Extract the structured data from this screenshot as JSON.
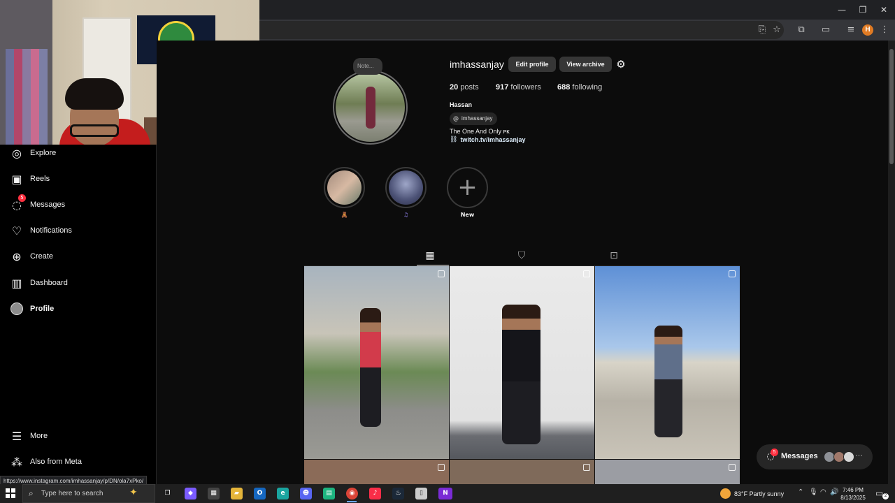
{
  "browser": {
    "window_controls": {
      "minimize": "—",
      "restore": "❐",
      "close": "✕"
    },
    "toolbar_icons": [
      "install-app-icon",
      "star-icon",
      "extensions-icon",
      "split-tab-icon",
      "media-icon"
    ],
    "profile_initial": "H",
    "menu_glyph": "⋮"
  },
  "sidebar": {
    "items": [
      {
        "label": "Explore",
        "icon": "compass-icon",
        "glyph": "◎"
      },
      {
        "label": "Reels",
        "icon": "reels-icon",
        "glyph": "▣"
      },
      {
        "label": "Messages",
        "icon": "messenger-icon",
        "glyph": "◌",
        "badge": "5"
      },
      {
        "label": "Notifications",
        "icon": "heart-icon",
        "glyph": "♡"
      },
      {
        "label": "Create",
        "icon": "plus-square-icon",
        "glyph": "⊕"
      },
      {
        "label": "Dashboard",
        "icon": "chart-icon",
        "glyph": "▥"
      },
      {
        "label": "Profile",
        "icon": "profile-avatar-icon",
        "glyph": ""
      }
    ],
    "more": {
      "label": "More",
      "glyph": "☰"
    },
    "also_from_meta": {
      "label": "Also from Meta",
      "glyph": "⁂"
    }
  },
  "status_url": "https://www.instagram.com/imhassanjay/p/DN/ola7xPko/",
  "profile": {
    "note_placeholder": "Note...",
    "username": "imhassanjay",
    "edit_profile_label": "Edit profile",
    "view_archive_label": "View archive",
    "stats": {
      "posts_count": "20",
      "posts_label": "posts",
      "followers_count": "917",
      "followers_label": "followers",
      "following_count": "688",
      "following_label": "following"
    },
    "full_name": "Hassan",
    "threads_handle": "imhassanjay",
    "bio": "The One And Only ᴘᴋ",
    "link": "twitch.tv/imhassanjay"
  },
  "highlights": [
    {
      "label": "🧸",
      "color": "#b89a88"
    },
    {
      "label": "♫",
      "color": "#5b6086"
    },
    {
      "label": "New",
      "color": "#121212"
    }
  ],
  "tabs": [
    {
      "name": "posts",
      "icon": "grid-icon",
      "glyph": "▦",
      "active": true
    },
    {
      "name": "saved",
      "icon": "bookmark-icon",
      "glyph": "🔖",
      "active": false
    },
    {
      "name": "tagged",
      "icon": "tagged-icon",
      "glyph": "◙",
      "active": false
    }
  ],
  "messages_pill": {
    "label": "Messages",
    "badge": "5",
    "more": "···"
  },
  "taskbar": {
    "search_placeholder": "Type here to search",
    "weather": "83°F  Partly sunny",
    "time": "7:46 PM",
    "date": "8/13/2025",
    "notification_count": "2",
    "apps": [
      {
        "name": "task-view",
        "glyph": "❐",
        "color": "transparent"
      },
      {
        "name": "copilot",
        "glyph": "◆",
        "color": "#7b5cff"
      },
      {
        "name": "store",
        "glyph": "▦",
        "color": "#444"
      },
      {
        "name": "file-explorer",
        "glyph": "▰",
        "color": "#e5b53a"
      },
      {
        "name": "outlook",
        "glyph": "O",
        "color": "#1567c0"
      },
      {
        "name": "edge",
        "glyph": "e",
        "color": "#1aa5a0"
      },
      {
        "name": "discord",
        "glyph": "☻",
        "color": "#5865f2"
      },
      {
        "name": "app-green",
        "glyph": "▤",
        "color": "#1db47f"
      },
      {
        "name": "chrome",
        "glyph": "◉",
        "color": "#db4437"
      },
      {
        "name": "music",
        "glyph": "♪",
        "color": "#fa2d48"
      },
      {
        "name": "steam",
        "glyph": "♨",
        "color": "#1b2838"
      },
      {
        "name": "notepad",
        "glyph": "▯",
        "color": "#ccc"
      },
      {
        "name": "nzxt",
        "glyph": "N",
        "color": "#7a2bd6"
      }
    ]
  }
}
